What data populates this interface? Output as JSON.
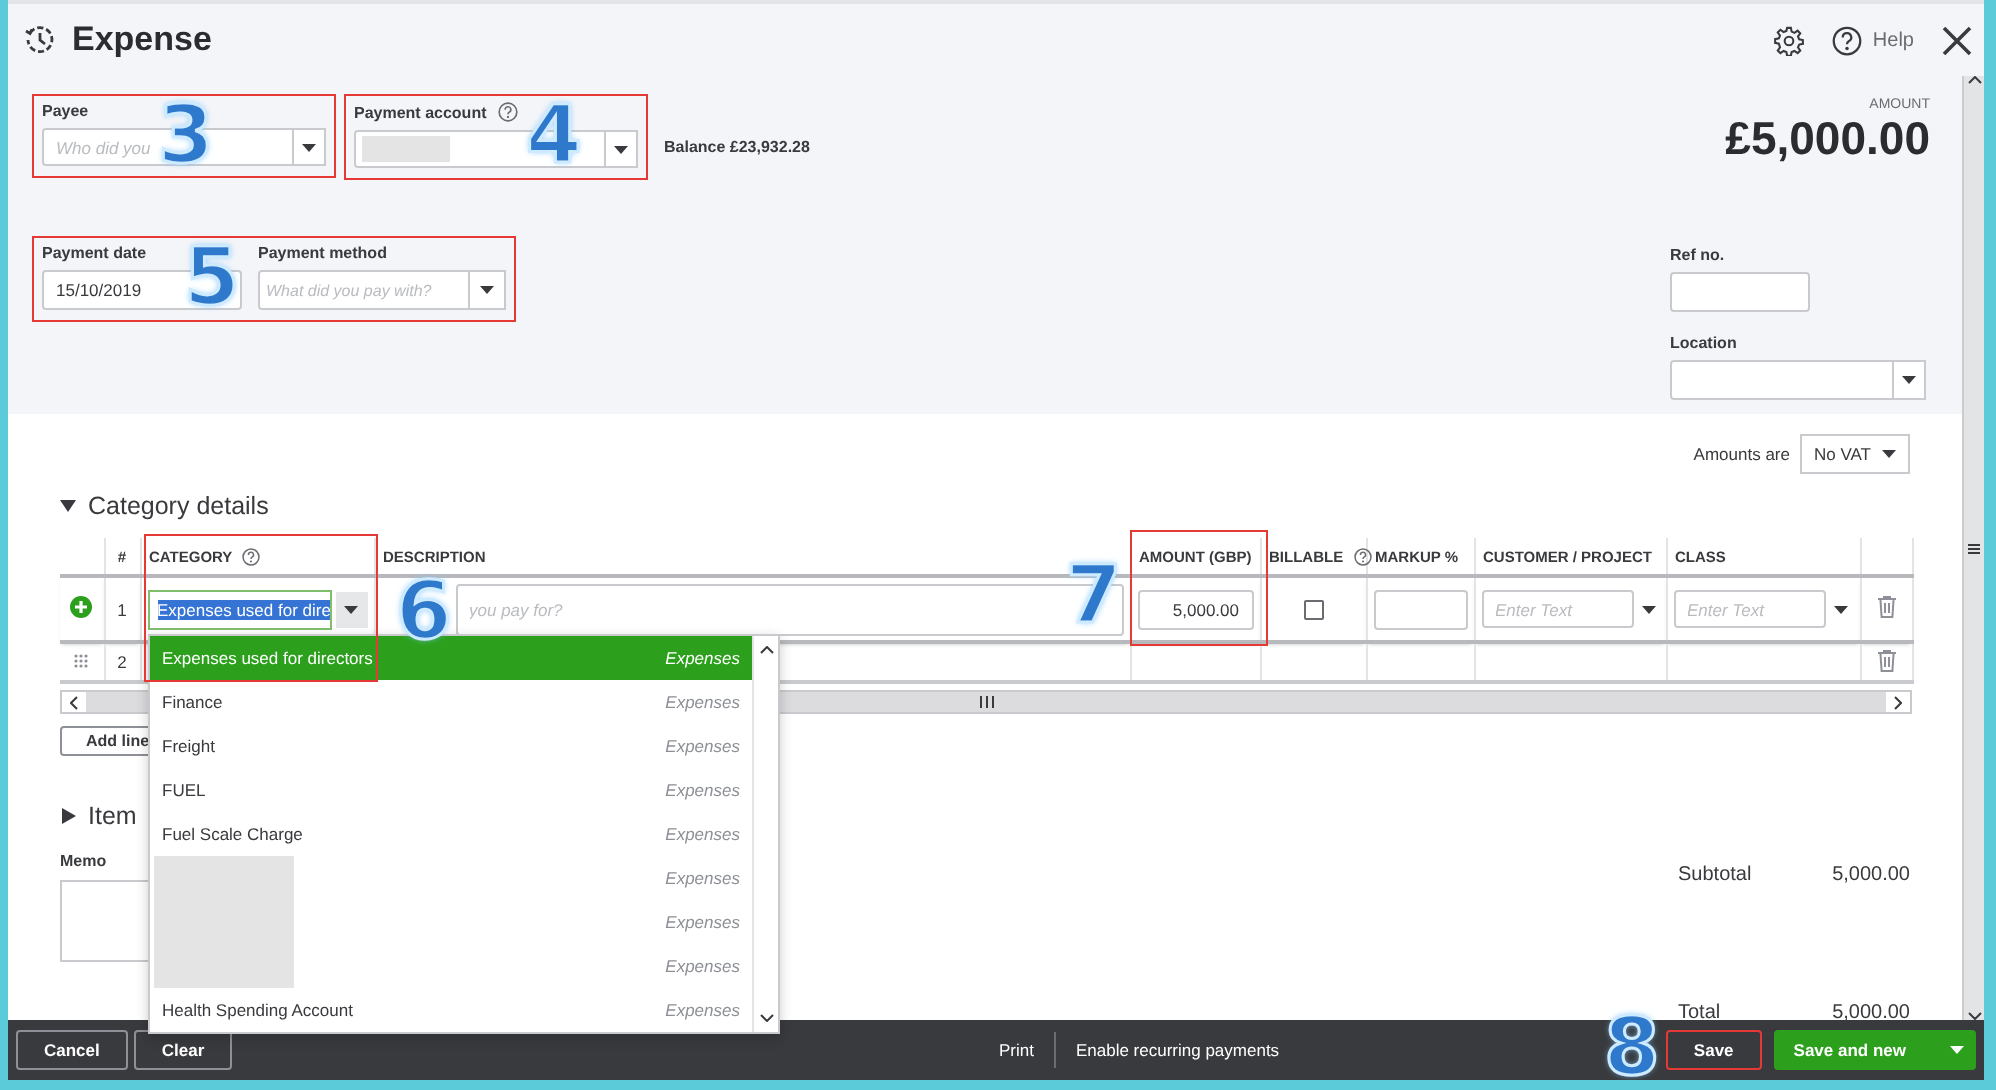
{
  "header": {
    "title": "Expense",
    "help": "Help"
  },
  "payee": {
    "label": "Payee",
    "placeholder": "Who did you",
    "marker": "3"
  },
  "payment_account": {
    "label": "Payment account",
    "value_redacted": true,
    "marker": "4"
  },
  "balance": "Balance £23,932.28",
  "amount": {
    "label": "AMOUNT",
    "value": "£5,000.00"
  },
  "payment_group": {
    "marker": "5",
    "date": {
      "label": "Payment date",
      "value": "15/10/2019"
    },
    "method": {
      "label": "Payment method",
      "placeholder": "What did you pay with?"
    }
  },
  "ref_no": {
    "label": "Ref no."
  },
  "location": {
    "label": "Location"
  },
  "amounts_are": {
    "label": "Amounts are",
    "value": "No VAT"
  },
  "category_details": {
    "title": "Category details",
    "expanded": true,
    "category_marker": "6",
    "amount_marker": "7",
    "add_lines": "Add line",
    "columns": [
      {
        "label": "#",
        "help": false
      },
      {
        "label": "CATEGORY",
        "help": true
      },
      {
        "label": "DESCRIPTION",
        "help": false
      },
      {
        "label": "AMOUNT (GBP)",
        "help": false
      },
      {
        "label": "BILLABLE",
        "help": true
      },
      {
        "label": "MARKUP %",
        "help": false
      },
      {
        "label": "CUSTOMER / PROJECT",
        "help": false
      },
      {
        "label": "CLASS",
        "help": false
      }
    ],
    "rows": [
      {
        "number": "1",
        "active": true,
        "category": "Expenses used for dire",
        "description_placeholder": "you pay for?",
        "amount": "5,000.00",
        "billable": false,
        "customer_placeholder": "Enter Text",
        "class_placeholder": "Enter Text"
      },
      {
        "number": "2",
        "active": false
      }
    ]
  },
  "category_dropdown": {
    "items": [
      {
        "name": "Expenses used for directors",
        "type": "Expenses",
        "selected": true,
        "redacted": false
      },
      {
        "name": "Finance",
        "type": "Expenses",
        "selected": false,
        "redacted": false
      },
      {
        "name": "Freight",
        "type": "Expenses",
        "selected": false,
        "redacted": false
      },
      {
        "name": "FUEL",
        "type": "Expenses",
        "selected": false,
        "redacted": false
      },
      {
        "name": "Fuel Scale Charge",
        "type": "Expenses",
        "selected": false,
        "redacted": false
      },
      {
        "type": "Expenses",
        "selected": false,
        "redacted": true
      },
      {
        "type": "Expenses",
        "selected": false,
        "redacted": true
      },
      {
        "type": "Expenses",
        "selected": false,
        "redacted": true
      },
      {
        "name": "Health Spending Account",
        "type": "Expenses",
        "selected": false,
        "redacted": false
      }
    ]
  },
  "item_details": {
    "title": "Item",
    "expanded": false
  },
  "memo": {
    "label": "Memo"
  },
  "totals": [
    {
      "label": "Subtotal",
      "value": "5,000.00"
    },
    {
      "label": "Total",
      "value": "5,000.00"
    }
  ],
  "footer": {
    "cancel": "Cancel",
    "clear": "Clear",
    "print": "Print",
    "recurring": "Enable recurring payments",
    "save": "Save",
    "save_marker": "8",
    "save_and_new": "Save and new"
  }
}
